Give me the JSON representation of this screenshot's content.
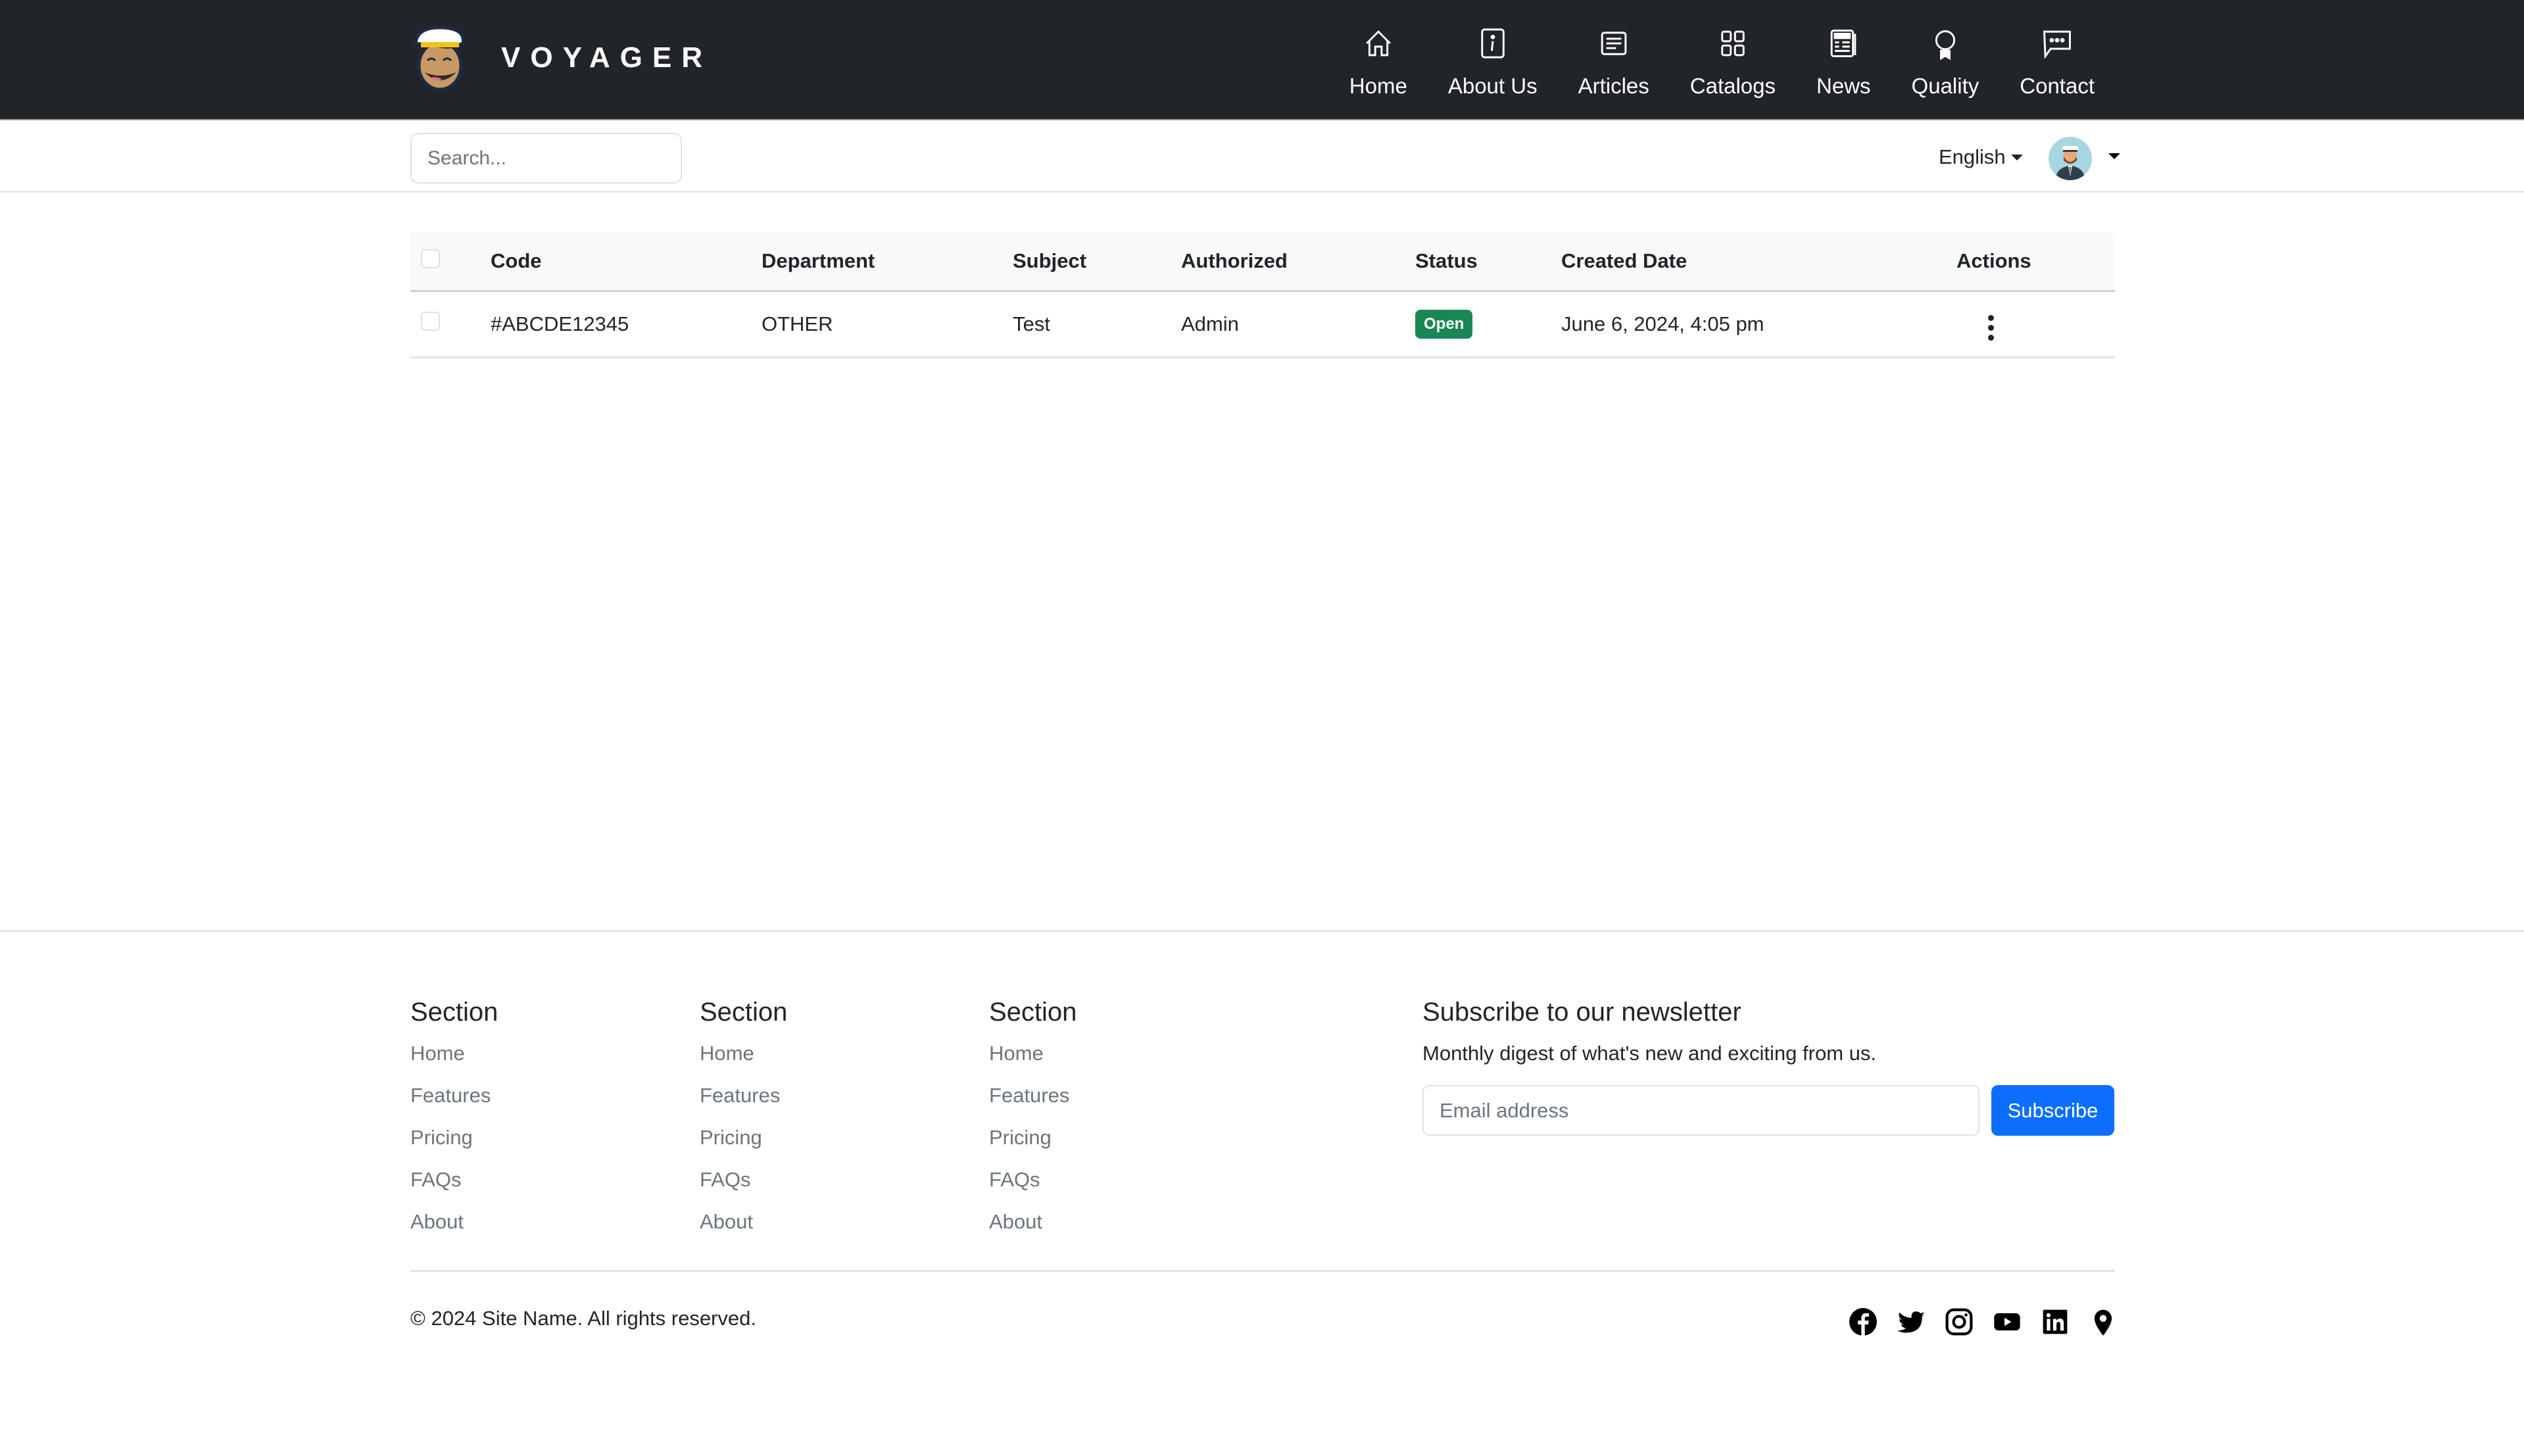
{
  "brand": {
    "name": "VOYAGER"
  },
  "nav": {
    "items": [
      {
        "label": "Home",
        "icon": "house-icon"
      },
      {
        "label": "About Us",
        "icon": "info-square-icon"
      },
      {
        "label": "Articles",
        "icon": "card-text-icon"
      },
      {
        "label": "Catalogs",
        "icon": "grid-icon"
      },
      {
        "label": "News",
        "icon": "newspaper-icon"
      },
      {
        "label": "Quality",
        "icon": "award-icon"
      },
      {
        "label": "Contact",
        "icon": "chat-dots-icon"
      }
    ]
  },
  "subbar": {
    "search_placeholder": "Search...",
    "language": "English"
  },
  "table": {
    "headers": [
      "Code",
      "Department",
      "Subject",
      "Authorized",
      "Status",
      "Created Date",
      "Actions"
    ],
    "rows": [
      {
        "code": "#ABCDE12345",
        "department": "OTHER",
        "subject": "Test",
        "authorized": "Admin",
        "status": "Open",
        "created": "June 6, 2024, 4:05 pm"
      }
    ]
  },
  "colors": {
    "navbar": "#212529",
    "status_open": "#198754",
    "primary": "#0d6efd"
  },
  "footer": {
    "sections": [
      {
        "title": "Section",
        "links": [
          "Home",
          "Features",
          "Pricing",
          "FAQs",
          "About"
        ]
      },
      {
        "title": "Section",
        "links": [
          "Home",
          "Features",
          "Pricing",
          "FAQs",
          "About"
        ]
      },
      {
        "title": "Section",
        "links": [
          "Home",
          "Features",
          "Pricing",
          "FAQs",
          "About"
        ]
      }
    ],
    "newsletter": {
      "title": "Subscribe to our newsletter",
      "description": "Monthly digest of what's new and exciting from us.",
      "email_placeholder": "Email address",
      "button": "Subscribe"
    },
    "copyright": "© 2024 Site Name. All rights reserved.",
    "social": [
      "facebook-icon",
      "twitter-icon",
      "instagram-icon",
      "youtube-icon",
      "linkedin-icon",
      "location-pin-icon"
    ]
  }
}
